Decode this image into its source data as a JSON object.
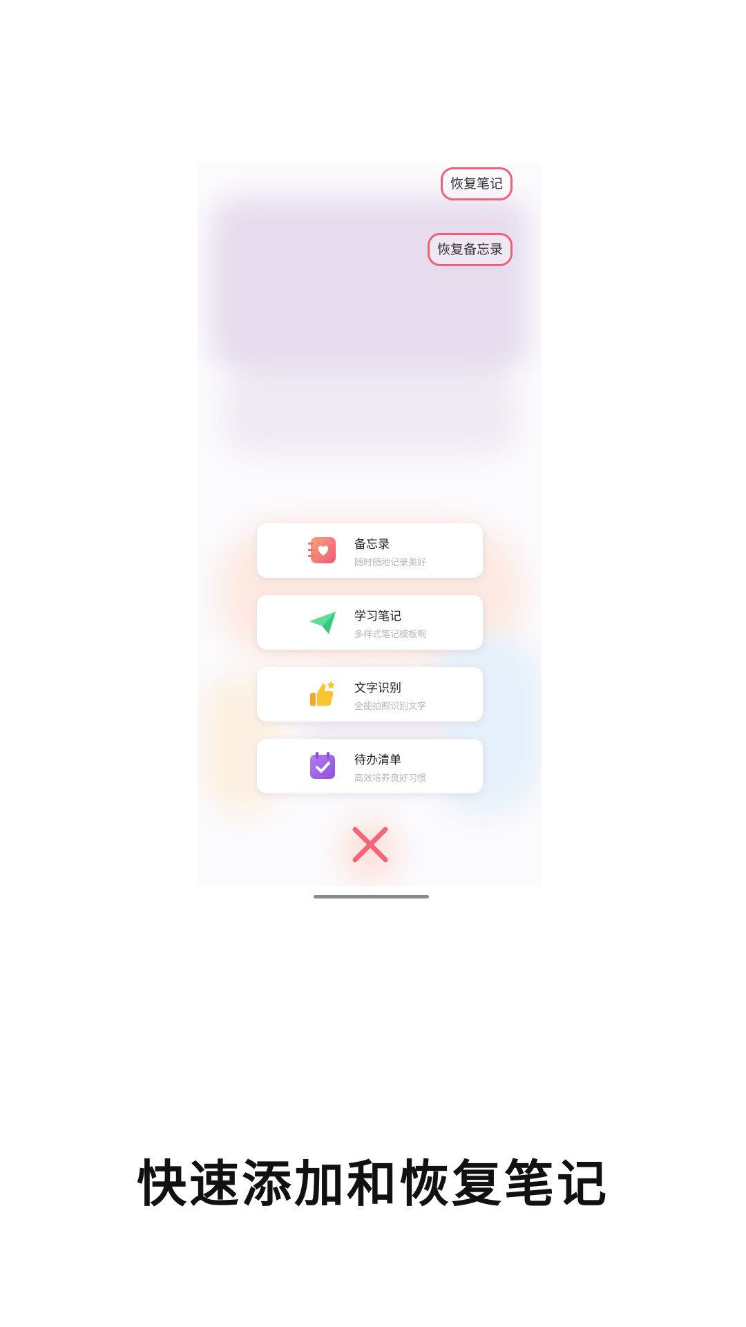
{
  "restore": {
    "note_label": "恢复笔记",
    "memo_label": "恢复备忘录"
  },
  "menu": {
    "items": [
      {
        "title": "备忘录",
        "subtitle": "随时随地记录美好",
        "icon": "memo-heart-icon",
        "color": "#f06b78"
      },
      {
        "title": "学习笔记",
        "subtitle": "多样式笔记模板啊",
        "icon": "paper-plane-icon",
        "color": "#2ec27a"
      },
      {
        "title": "文字识别",
        "subtitle": "全能拍照识别文字",
        "icon": "thumbs-up-icon",
        "color": "#f7b82b"
      },
      {
        "title": "待办清单",
        "subtitle": "高效培养良好习惯",
        "icon": "calendar-check-icon",
        "color": "#9d5ce6"
      }
    ]
  },
  "close": {
    "icon": "close-icon",
    "color": "#f36577"
  },
  "caption": "快速添加和恢复笔记"
}
